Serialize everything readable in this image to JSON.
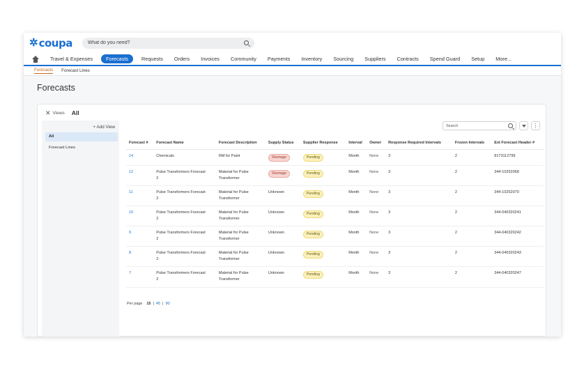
{
  "brand": {
    "logo_text": "coupa",
    "logo_color": "#1a6fd1"
  },
  "search": {
    "placeholder": "What do you need?"
  },
  "nav": {
    "items": [
      {
        "label": "Travel & Expenses"
      },
      {
        "label": "Forecasts",
        "active": true
      },
      {
        "label": "Requests"
      },
      {
        "label": "Orders"
      },
      {
        "label": "Invoices"
      },
      {
        "label": "Community"
      },
      {
        "label": "Payments"
      },
      {
        "label": "Inventory"
      },
      {
        "label": "Sourcing"
      },
      {
        "label": "Suppliers"
      },
      {
        "label": "Contracts"
      },
      {
        "label": "Spend Guard"
      },
      {
        "label": "Setup"
      },
      {
        "label": "More..."
      }
    ]
  },
  "subnav": {
    "items": [
      {
        "label": "Forecasts",
        "active": true
      },
      {
        "label": "Forecast Lines"
      }
    ]
  },
  "page": {
    "title": "Forecasts"
  },
  "views": {
    "label": "Views",
    "current": "All",
    "add_view": "+ Add View",
    "items": [
      {
        "label": "All",
        "selected": true
      },
      {
        "label": "Forecast Lines"
      }
    ]
  },
  "table_search": {
    "placeholder": "Search"
  },
  "table": {
    "columns": [
      "Forecast #",
      "Forecast Name",
      "Forecast Description",
      "Supply Status",
      "Supplier Response",
      "Interval",
      "Owner",
      "Response Required Intervals",
      "Frozen Intervals",
      "Ext Forecast Header #"
    ],
    "rows": [
      {
        "id": "14",
        "name": [
          "Chemicals",
          ""
        ],
        "desc": [
          "RM for Paint",
          ""
        ],
        "supply": "Shortage",
        "response": "Pending",
        "interval": "Month",
        "owner": "None",
        "rri": "3",
        "frozen": "2",
        "ext": "8173112799"
      },
      {
        "id": "12",
        "name": [
          "Pulse Transformers Forecast",
          "2"
        ],
        "desc": [
          "Material for Pulse",
          "Transformer"
        ],
        "supply": "Shortage",
        "response": "Pending",
        "interval": "Month",
        "owner": "None",
        "rri": "3",
        "frozen": "2",
        "ext": "344-10252068"
      },
      {
        "id": "11",
        "name": [
          "Pulse Transformers Forecast",
          "2"
        ],
        "desc": [
          "Material for Pulse",
          "Transformer"
        ],
        "supply": "Unknown",
        "response": "Pending",
        "interval": "Month",
        "owner": "None",
        "rri": "3",
        "frozen": "2",
        "ext": "344-10252070"
      },
      {
        "id": "10",
        "name": [
          "Pulse Transformers Forecast",
          "2"
        ],
        "desc": [
          "Material for Pulse",
          "Transformer"
        ],
        "supply": "Unknown",
        "response": "Pending",
        "interval": "Month",
        "owner": "None",
        "rri": "3",
        "frozen": "2",
        "ext": "344-040320241"
      },
      {
        "id": "9",
        "name": [
          "Pulse Transformers Forecast",
          "2"
        ],
        "desc": [
          "Material for Pulse",
          "Transformer"
        ],
        "supply": "Unknown",
        "response": "Pending",
        "interval": "Month",
        "owner": "None",
        "rri": "3",
        "frozen": "2",
        "ext": "344-040320242"
      },
      {
        "id": "8",
        "name": [
          "Pulse Transformers Forecast",
          "2"
        ],
        "desc": [
          "Material for Pulse",
          "Transformer"
        ],
        "supply": "Unknown",
        "response": "Pending",
        "interval": "Month",
        "owner": "None",
        "rri": "3",
        "frozen": "2",
        "ext": "344-040320243"
      },
      {
        "id": "7",
        "name": [
          "Pulse Transformers Forecast",
          "2"
        ],
        "desc": [
          "Material for Pulse",
          "Transformer"
        ],
        "supply": "Unknown",
        "response": "Pending",
        "interval": "Month",
        "owner": "None",
        "rri": "3",
        "frozen": "2",
        "ext": "344-040320247"
      }
    ]
  },
  "pager": {
    "label": "Per page",
    "options": [
      "15",
      "45",
      "90"
    ],
    "current": "15",
    "separator": "|"
  },
  "colors": {
    "accent": "#1a6fd1",
    "active_subnav": "#c6661b",
    "shortage_bg": "#f7d6d2",
    "pending_bg": "#fbf1bd"
  }
}
